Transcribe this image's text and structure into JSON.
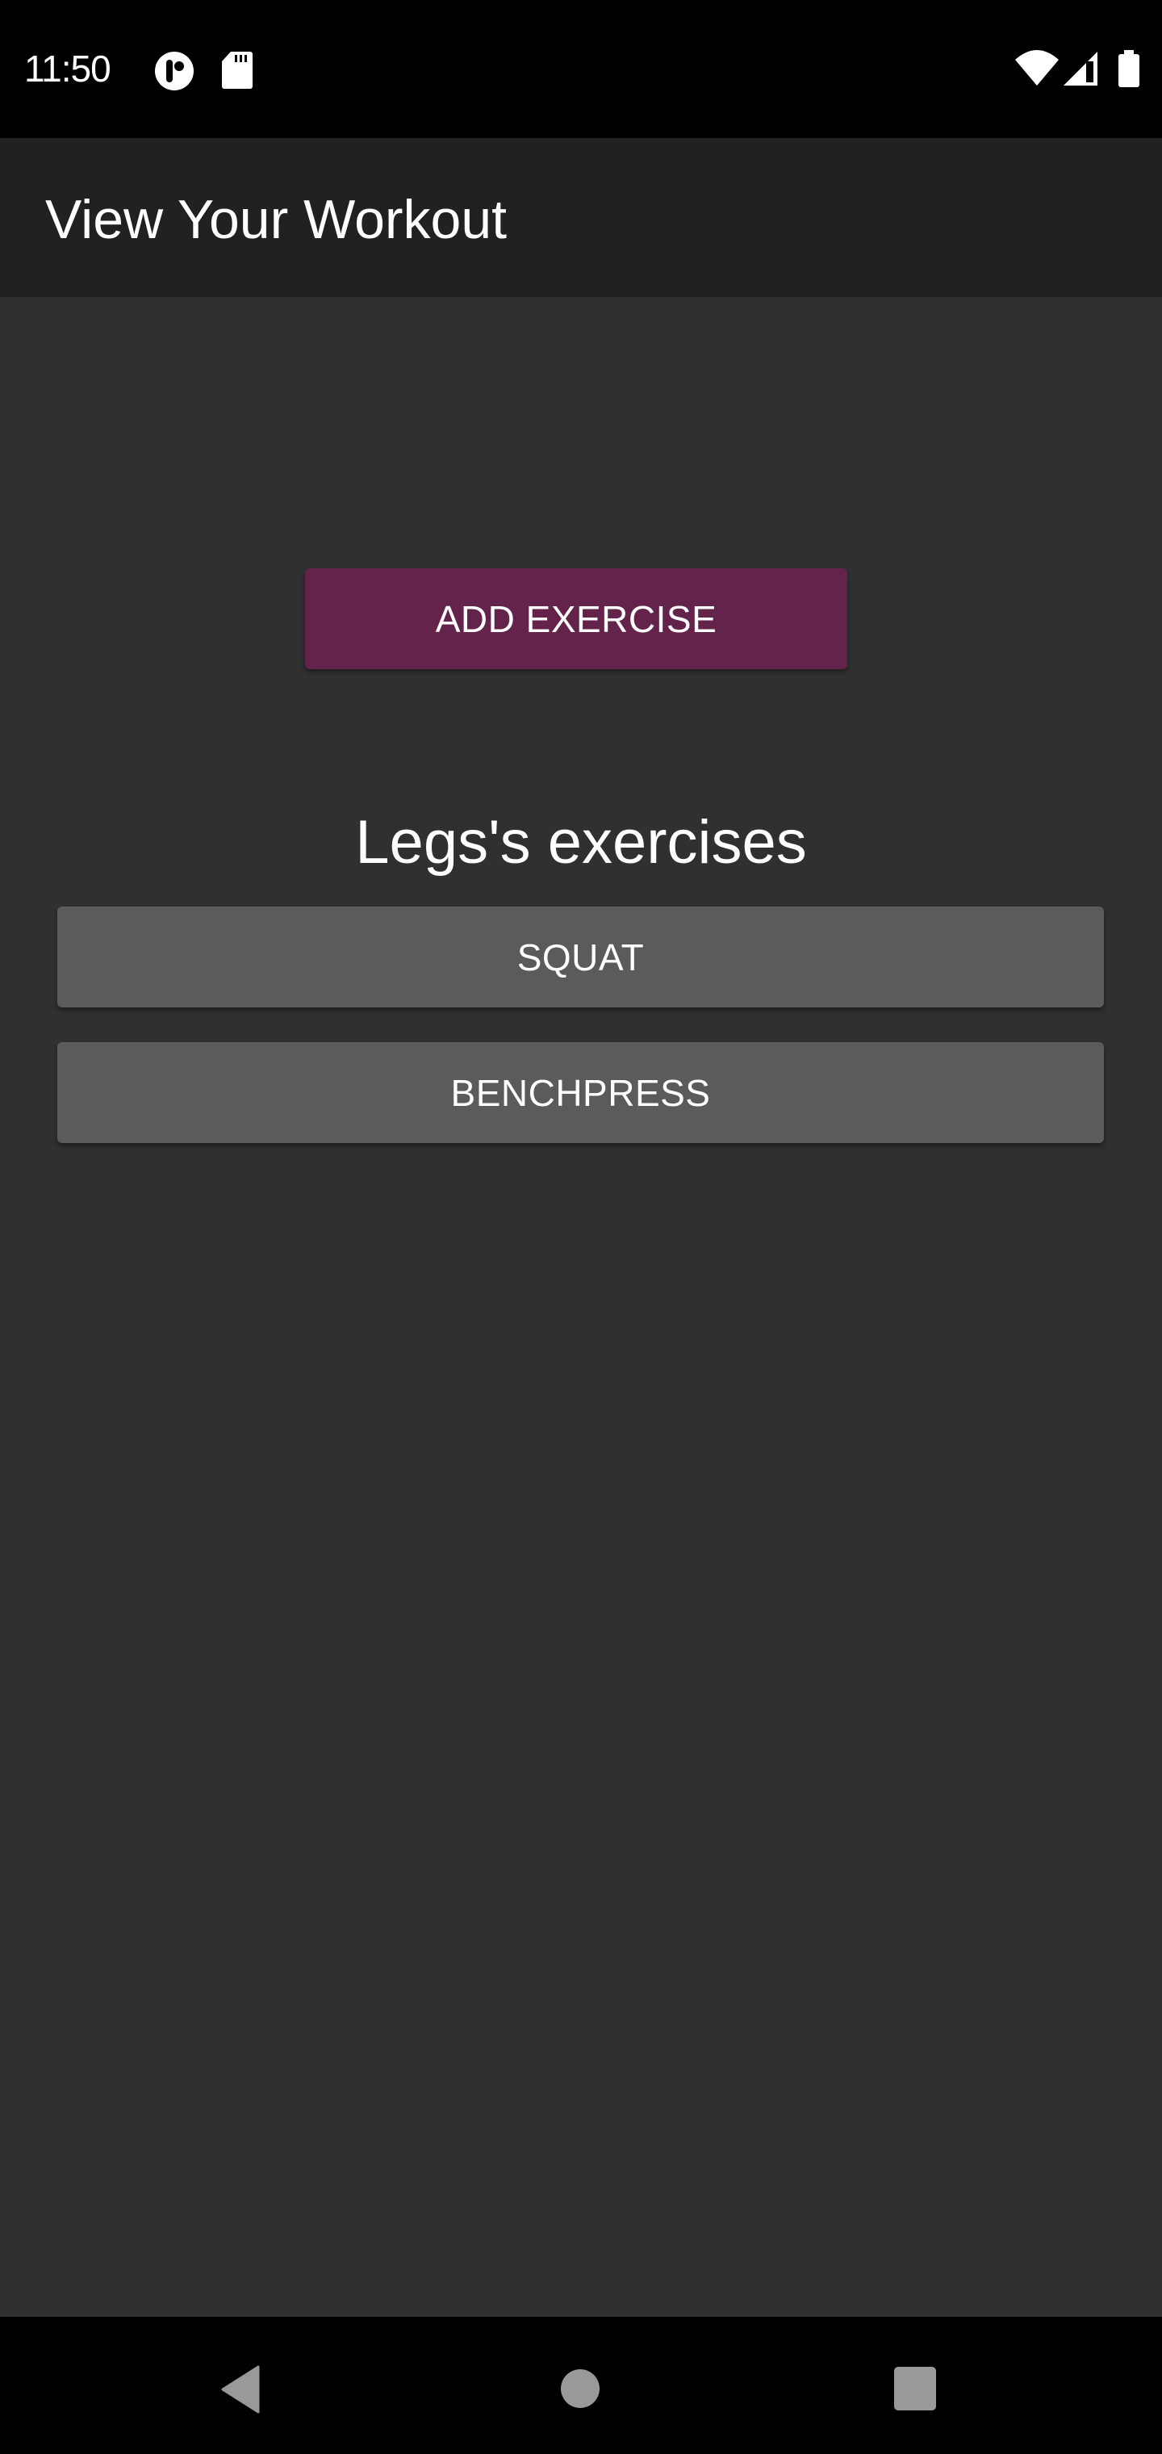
{
  "status_bar": {
    "time": "11:50",
    "left_icons": [
      "notification-app-icon",
      "sd-card-icon"
    ],
    "right_icons": [
      "wifi-icon",
      "cell-signal-icon",
      "battery-icon"
    ]
  },
  "app_bar": {
    "title": "View Your Workout"
  },
  "main": {
    "add_exercise_label": "ADD EXERCISE",
    "section_title": "Legs's exercises",
    "exercises": [
      {
        "label": "SQUAT"
      },
      {
        "label": "BENCHPRESS"
      }
    ]
  },
  "nav_bar": {
    "icons": [
      "back-icon",
      "home-icon",
      "recents-icon"
    ]
  },
  "colors": {
    "accent": "#63234a",
    "exercise_button": "#5b5b5d",
    "background": "#303030",
    "app_bar": "#212121"
  }
}
